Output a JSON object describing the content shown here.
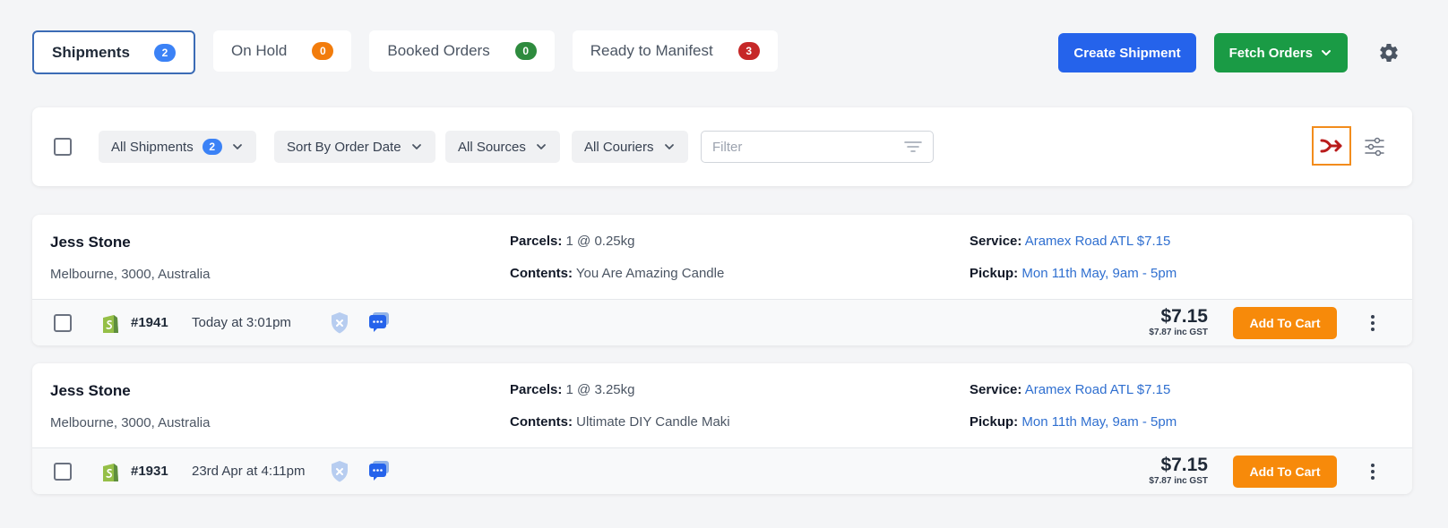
{
  "tabs": [
    {
      "label": "Shipments",
      "count": "2",
      "color": "#3b82f6"
    },
    {
      "label": "On Hold",
      "count": "0",
      "color": "#f27c0c"
    },
    {
      "label": "Booked Orders",
      "count": "0",
      "color": "#2e8b3e"
    },
    {
      "label": "Ready to Manifest",
      "count": "3",
      "color": "#c62828"
    }
  ],
  "actions": {
    "create_label": "Create Shipment",
    "fetch_label": "Fetch Orders",
    "settings_icon": "gear-icon"
  },
  "filters": {
    "all_shipments": {
      "label": "All Shipments",
      "count": "2"
    },
    "sort_label": "Sort By Order Date",
    "sources_label": "All Sources",
    "couriers_label": "All Couriers",
    "search_placeholder": "Filter"
  },
  "labels": {
    "parcels": "Parcels:",
    "contents": "Contents:",
    "service": "Service:",
    "pickup": "Pickup:",
    "add_to_cart": "Add To Cart"
  },
  "shipments": [
    {
      "name": "Jess Stone",
      "address": "Melbourne, 3000, Australia",
      "parcels": "1 @ 0.25kg",
      "contents": "You Are Amazing Candle",
      "service": "Aramex Road ATL $7.15",
      "pickup": "Mon 11th May, 9am - 5pm",
      "order_no": "#1941",
      "date": "Today at 3:01pm",
      "price": "$7.15",
      "price_gst": "$7.87 inc GST"
    },
    {
      "name": "Jess Stone",
      "address": "Melbourne, 3000, Australia",
      "parcels": "1 @ 3.25kg",
      "contents": "Ultimate DIY Candle Maki",
      "service": "Aramex Road ATL $7.15",
      "pickup": "Mon 11th May, 9am - 5pm",
      "order_no": "#1931",
      "date": "23rd Apr at 4:11pm",
      "price": "$7.15",
      "price_gst": "$7.87 inc GST"
    }
  ]
}
